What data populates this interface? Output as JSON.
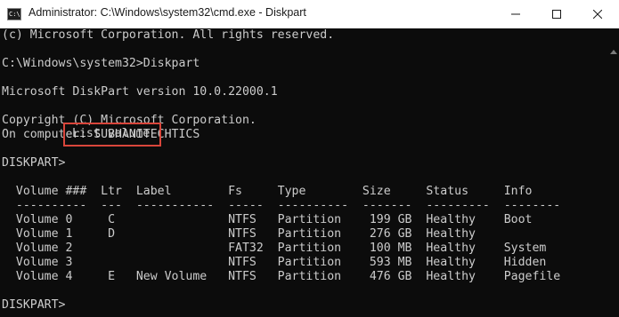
{
  "window": {
    "title": "Administrator: C:\\Windows\\system32\\cmd.exe - Diskpart",
    "app_icon_text": "C:\\."
  },
  "console": {
    "lines": [
      "(c) Microsoft Corporation. All rights reserved.",
      "",
      "C:\\Windows\\system32>Diskpart",
      "",
      "Microsoft DiskPart version 10.0.22000.1",
      "",
      "Copyright (C) Microsoft Corporation.",
      "On computer: SUBHANITECHTICS",
      "",
      "DISKPART>",
      "",
      "  Volume ###  Ltr  Label        Fs     Type        Size     Status     Info",
      "  ----------  ---  -----------  -----  ----------  -------  ---------  --------",
      "  Volume 0     C                NTFS   Partition    199 GB  Healthy    Boot",
      "  Volume 1     D                NTFS   Partition    276 GB  Healthy",
      "  Volume 2                      FAT32  Partition    100 MB  Healthy    System",
      "  Volume 3                      NTFS   Partition    593 MB  Healthy    Hidden",
      "  Volume 4     E   New Volume   NTFS   Partition    476 GB  Healthy    Pagefile",
      "",
      "DISKPART>"
    ],
    "highlighted_command": "List volume",
    "highlight_color": "#d9463b",
    "text_color": "#cccccc",
    "background_color": "#0c0c0c"
  }
}
